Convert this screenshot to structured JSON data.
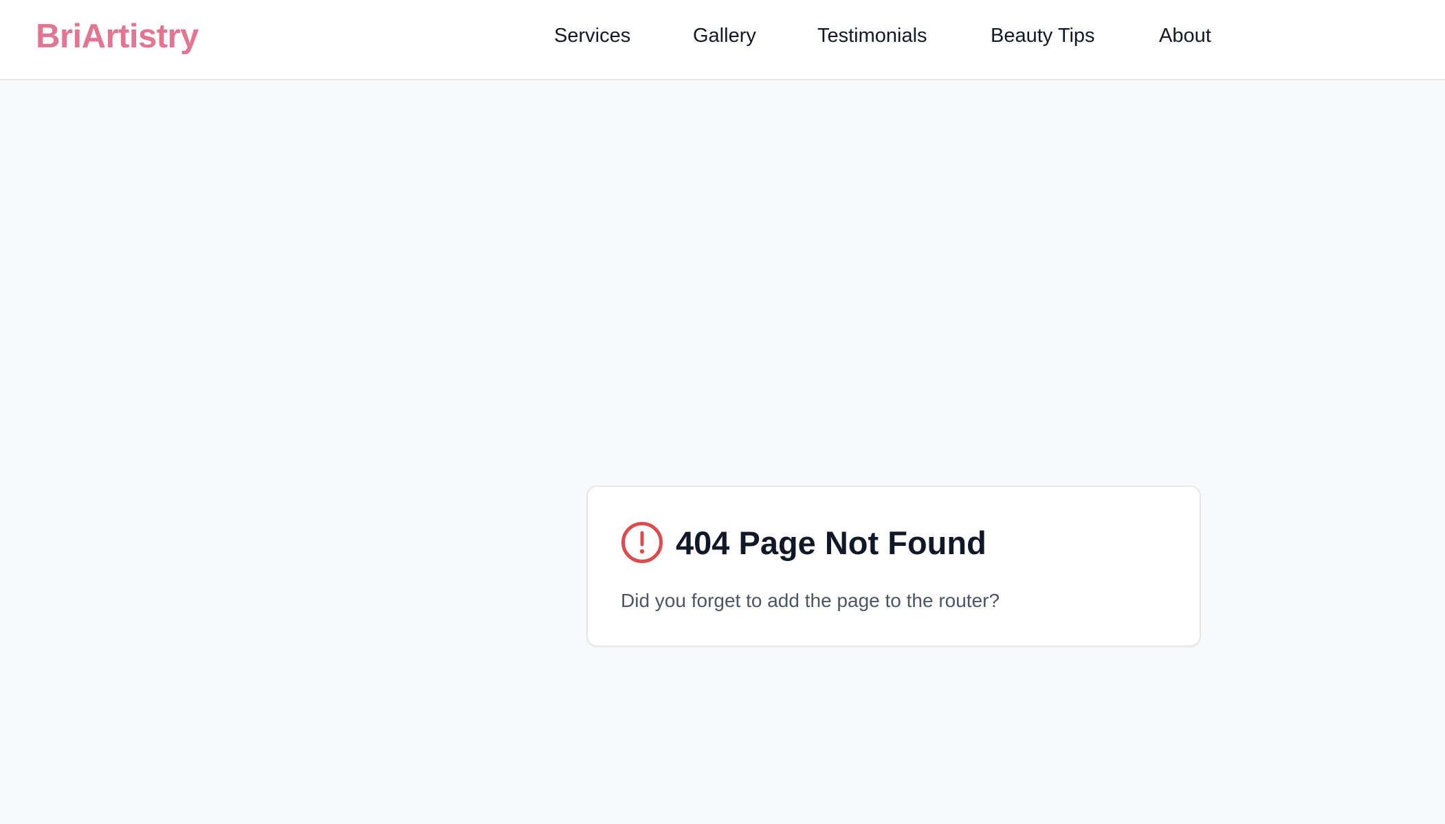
{
  "header": {
    "logo": "BriArtistry",
    "nav": [
      {
        "label": "Services"
      },
      {
        "label": "Gallery"
      },
      {
        "label": "Testimonials"
      },
      {
        "label": "Beauty Tips"
      },
      {
        "label": "About"
      }
    ]
  },
  "error_card": {
    "icon": "alert-circle-icon",
    "title": "404 Page Not Found",
    "message": "Did you forget to add the page to the router?"
  },
  "colors": {
    "brand": "#e27591",
    "error": "#dc4c4c",
    "background": "#f8f9fb"
  }
}
